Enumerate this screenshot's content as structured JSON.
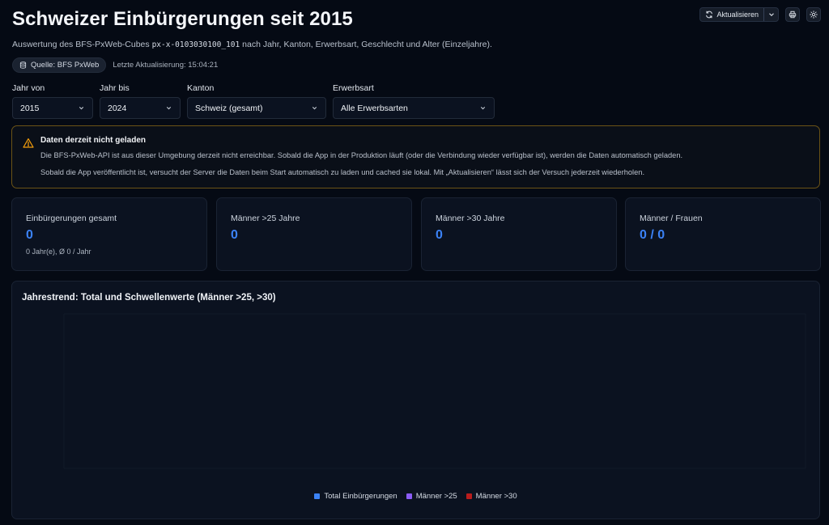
{
  "header": {
    "title": "Schweizer Einbürgerungen seit 2015",
    "subtitle_pre": "Auswertung des BFS-PxWeb-Cubes ",
    "subtitle_code": "px-x-0103030100_101",
    "subtitle_post": " nach Jahr, Kanton, Erwerbsart, Geschlecht und Alter (Einzeljahre).",
    "source_badge": "Quelle: BFS PxWeb",
    "last_update": "Letzte Aktualisierung: 15:04:21"
  },
  "toolbar": {
    "refresh_label": "Aktualisieren",
    "icons": [
      "refresh-icon",
      "chevron-down-icon",
      "printer-icon",
      "sun-icon"
    ]
  },
  "filters": {
    "year_from": {
      "label": "Jahr von",
      "value": "2015"
    },
    "year_to": {
      "label": "Jahr bis",
      "value": "2024"
    },
    "canton": {
      "label": "Kanton",
      "value": "Schweiz (gesamt)"
    },
    "acquisition": {
      "label": "Erwerbsart",
      "value": "Alle Erwerbsarten"
    }
  },
  "alert": {
    "title": "Daten derzeit nicht geladen",
    "line1": "Die BFS-PxWeb-API ist aus dieser Umgebung derzeit nicht erreichbar. Sobald die App in der Produktion läuft (oder die Verbindung wieder verfügbar ist), werden die Daten automatisch geladen.",
    "line2": "Sobald die App veröffentlicht ist, versucht der Server die Daten beim Start automatisch zu laden und cached sie lokal. Mit „Aktualisieren“ lässt sich der Versuch jederzeit wiederholen.",
    "border_color": "#6b5316",
    "icon_color": "#f59e0b"
  },
  "kpis": [
    {
      "label": "Einbürgerungen gesamt",
      "value": "0",
      "sub": "0 Jahr(e), Ø 0 / Jahr"
    },
    {
      "label": "Männer >25 Jahre",
      "value": "0",
      "sub": ""
    },
    {
      "label": "Männer >30 Jahre",
      "value": "0",
      "sub": ""
    },
    {
      "label": "Männer / Frauen",
      "value": "0 / 0",
      "sub": ""
    }
  ],
  "chart": {
    "title": "Jahrestrend: Total und Schwellenwerte (Männer >25, >30)",
    "legend": [
      {
        "name": "Total Einbürgerungen",
        "color": "#3b82f6"
      },
      {
        "name": "Männer >25",
        "color": "#8b5cf6"
      },
      {
        "name": "Männer >30",
        "color": "#b91c1c"
      }
    ]
  },
  "colors": {
    "accent": "#3b82f6",
    "background": "#050a14",
    "card": "#0b1220"
  }
}
